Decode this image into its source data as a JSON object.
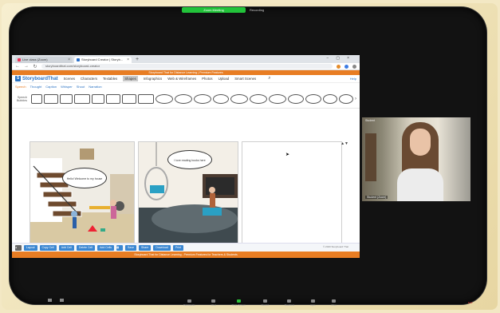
{
  "meeting": {
    "recording_badge": "Zoom Meeting",
    "top_label": "Recording"
  },
  "browser": {
    "tabs": [
      {
        "label": "Live class (Zoom)",
        "active": false
      },
      {
        "label": "Storyboard Creator | Storyb...",
        "active": true
      }
    ],
    "url": "storyboardthat.com/storyboard-creator"
  },
  "site": {
    "promo_top": "Storyboard That for Distance Learning | Premium Features",
    "logo": "StoryboardThat",
    "nav": [
      "Scenes",
      "Characters",
      "Textables",
      "Shapes",
      "Infographics",
      "Web & Wireframes",
      "Photos",
      "Upload",
      "Smart Scenes"
    ],
    "nav_selected_index": 3,
    "help": "Help",
    "categories": [
      "Speech",
      "Thought",
      "Caption",
      "Whisper",
      "Shout",
      "Narration"
    ],
    "bubbles_label": "Speech Bubbles",
    "buttons": [
      "Layout",
      "Copy Cell",
      "Add Cell",
      "Delete Cell",
      "Add Cells",
      "Save",
      "Share",
      "Download",
      "Print"
    ],
    "credit": "© 2020 Storyboard That",
    "promo_bottom": "Storyboard That for Distance Learning - Premium Features for Teachers & Students"
  },
  "storyboard": {
    "cells": [
      {
        "speech": "Hello! Welcome to my house"
      },
      {
        "speech": "I love reading books here"
      },
      {
        "speech": ""
      }
    ]
  },
  "webcam": {
    "name_top": "Student",
    "name_bottom": "Student (Zoom)"
  },
  "toolbar": {
    "items": [
      "Mute",
      "Start Video",
      "Participants",
      "Chat",
      "Share Screen",
      "Record",
      "Reactions",
      "Apps",
      "Whiteboards",
      "More"
    ],
    "end": "End"
  }
}
